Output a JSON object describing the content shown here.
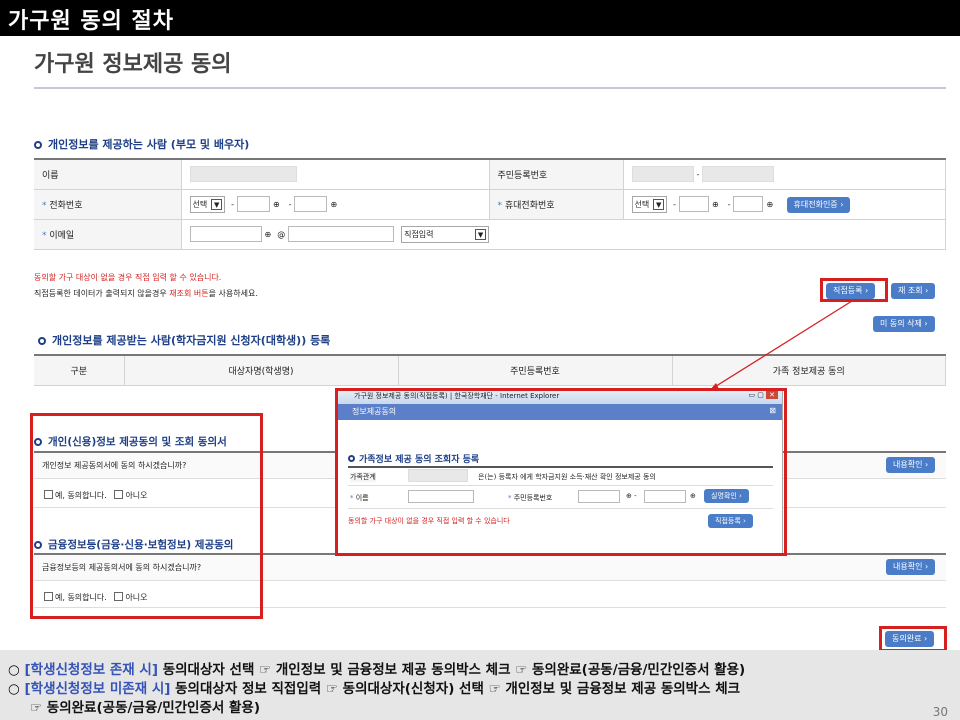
{
  "header": {
    "banner": "가구원 동의 절차",
    "title": "가구원 정보제공 동의"
  },
  "provider": {
    "section_title": "개인정보를 제공하는 사람 (부모 및 배우자)",
    "name_label": "이름",
    "rrn_label": "주민등록번호",
    "phone_label": "전화번호",
    "mobile_label": "휴대전화번호",
    "email_label": "이메일",
    "select_value": "선택",
    "dash": "-",
    "at": "@",
    "email_domain_value": "직접입력",
    "mobile_auth_button": "휴대전화인증"
  },
  "notes": {
    "line1": "동의할 가구 대상이 없을 경우 직접 입력 할 수 있습니다.",
    "line2_pre": "직접등록한 데이터가 출력되지 않을경우 ",
    "line2_red": "재조회 버튼",
    "line2_post": "을 사용하세요."
  },
  "buttons": {
    "direct_register": "직접등록",
    "reinquire": "재 조회",
    "delete_unconsented": "미 동의 삭제",
    "view1": "내용확인",
    "view2": "내용확인",
    "consent_complete": "동의완료"
  },
  "recipient": {
    "section_title": "개인정보를 제공받는 사람(학자금지원 신청자(대학생)) 등록",
    "columns": [
      "구분",
      "대상자명(학생명)",
      "주민등록번호",
      "가족 정보제공 동의"
    ]
  },
  "consent1": {
    "title": "개인(신용)정보 제공동의 및 조회 동의서",
    "question": "개인정보 제공동의서에 동의 하시겠습니까?",
    "agree": "예, 동의합니다.",
    "disagree": "아니오"
  },
  "consent2": {
    "title": "금융정보등(금융·신용·보험정보) 제공동의",
    "question": "금융정보등의 제공동의서에 동의 하시겠습니까?",
    "agree": "예, 동의합니다.",
    "disagree": "아니오"
  },
  "popup": {
    "window_title": "가구원 정보제공 동의(직접등록) | 한국장학재단 - Internet Explorer",
    "header": "정보제공동의",
    "section_title": "가족정보 제공 동의 조회자 등록",
    "relation_label": "가족관계",
    "relation_text": "은(는) 등록자 에게 학자금지원 소득·재산 확인 정보제공 동의",
    "name_label": "이름",
    "rrn_label": "주민등록번호",
    "verify_button": "실명확인",
    "note": "동의할 가구 대상이 없을 경우 직접 입력 할 수 있습니다",
    "register_button": "직접등록"
  },
  "footer": {
    "line1_hl": "[학생신청정보 존재 시]",
    "line1_text": "동의대상자 선택 ☞ 개인정보 및 금융정보 제공 동의박스 체크 ☞ 동의완료(공동/금융/민간인증서 활용)",
    "line2_hl": "[학생신청정보 미존재 시]",
    "line2_text": "동의대상자 정보 직접입력 ☞ 동의대상자(신청자) 선택 ☞ 개인정보 및 금융정보 제공 동의박스 체크",
    "line3_text": "☞ 동의완료(공동/금융/민간인증서 활용)",
    "page_number": "30"
  },
  "colors": {
    "accent_red": "#d62020",
    "button_blue": "#4a7cc8",
    "section_blue": "#1e3f86"
  }
}
